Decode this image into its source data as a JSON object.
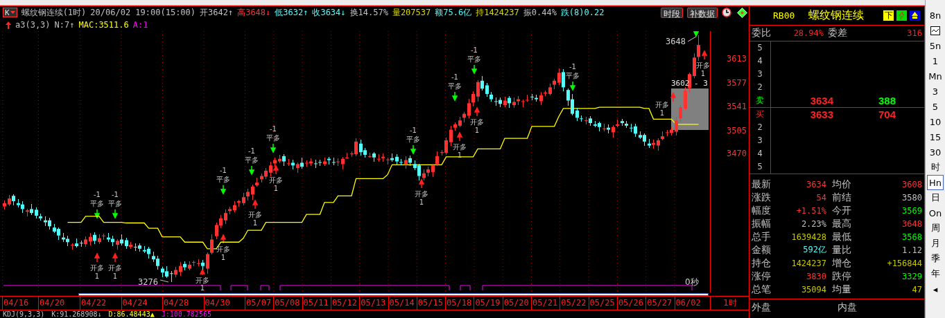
{
  "header": {
    "period_key": "K",
    "items": [
      {
        "text": "螺纹钢连续(1时)",
        "color": "#c0c0c0"
      },
      {
        "text": "20/06/02 19:00(15:00)",
        "color": "#c0c0c0"
      },
      {
        "text": "开3642↑",
        "color": "#c0c0c0"
      },
      {
        "text": "高3648↓",
        "color": "#ff3232"
      },
      {
        "text": "低3632↑",
        "color": "#54fcfc"
      },
      {
        "text": "收3634↓",
        "color": "#54fcfc"
      },
      {
        "text": "换14.57%",
        "color": "#c0c0c0"
      },
      {
        "text": "量207537",
        "color": "#d8d800"
      },
      {
        "text": "额75.6亿",
        "color": "#54fcfc"
      },
      {
        "text": "持1424237",
        "color": "#d8d800"
      },
      {
        "text": "振0.44%",
        "color": "#c0c0c0"
      },
      {
        "text": "跌(8)0.22",
        "color": "#54fcfc"
      }
    ],
    "buttons": [
      "时段",
      "补数据"
    ]
  },
  "indicator": [
    {
      "text": "a3(3,3)",
      "color": "#c0c0c0"
    },
    {
      "text": "N:7↑",
      "color": "#c0c0c0"
    },
    {
      "text": ":3511.6",
      "color": "#ffff00"
    },
    {
      "text": "A:1",
      "color": "#ff00ff"
    }
  ],
  "chart_data": {
    "type": "candlestick",
    "ylim": [
      3260,
      3655
    ],
    "yticks": [
      3470,
      3505,
      3541,
      3577,
      3613
    ],
    "ohlc": [
      [
        3390,
        3398,
        3386,
        3395
      ],
      [
        3393,
        3407,
        3391,
        3402
      ],
      [
        3406,
        3408,
        3392,
        3398
      ],
      [
        3395,
        3401,
        3389,
        3392
      ],
      [
        3393,
        3397,
        3381,
        3386
      ],
      [
        3382,
        3386,
        3375,
        3384
      ],
      [
        3386,
        3393,
        3378,
        3380
      ],
      [
        3385,
        3388,
        3372,
        3376
      ],
      [
        3375,
        3379,
        3369,
        3372
      ],
      [
        3369,
        3374,
        3361,
        3366
      ],
      [
        3369,
        3372,
        3356,
        3360
      ],
      [
        3358,
        3363,
        3350,
        3352
      ],
      [
        3356,
        3358,
        3340,
        3346
      ],
      [
        3343,
        3349,
        3337,
        3340
      ],
      [
        3341,
        3345,
        3331,
        3336
      ],
      [
        3332,
        3334,
        3325,
        3332
      ],
      [
        3334,
        3341,
        3328,
        3330
      ],
      [
        3335,
        3338,
        3330,
        3334
      ],
      [
        3333,
        3344,
        3330,
        3340
      ],
      [
        3337,
        3349,
        3332,
        3344
      ],
      [
        3347,
        3350,
        3334,
        3338
      ],
      [
        3336,
        3347,
        3334,
        3342
      ],
      [
        3346,
        3348,
        3340,
        3346
      ],
      [
        3343,
        3349,
        3337,
        3340
      ],
      [
        3341,
        3345,
        3331,
        3336
      ],
      [
        3332,
        3340,
        3325,
        3338
      ],
      [
        3340,
        3347,
        3332,
        3334
      ],
      [
        3339,
        3342,
        3326,
        3330
      ],
      [
        3329,
        3336,
        3326,
        3332
      ],
      [
        3329,
        3334,
        3323,
        3328
      ],
      [
        3331,
        3334,
        3322,
        3326
      ],
      [
        3324,
        3329,
        3320,
        3322
      ],
      [
        3326,
        3328,
        3312,
        3318
      ],
      [
        3315,
        3321,
        3307,
        3310
      ],
      [
        3311,
        3315,
        3295,
        3300
      ],
      [
        3296,
        3298,
        3283,
        3290
      ],
      [
        3292,
        3299,
        3282,
        3284
      ],
      [
        3289,
        3292,
        3276,
        3288
      ],
      [
        3287,
        3298,
        3284,
        3294
      ],
      [
        3291,
        3305,
        3286,
        3300
      ],
      [
        3303,
        3306,
        3294,
        3298
      ],
      [
        3296,
        3307,
        3294,
        3302
      ],
      [
        3306,
        3308,
        3300,
        3306
      ],
      [
        3303,
        3310,
        3300,
        3304
      ],
      [
        3305,
        3309,
        3295,
        3300
      ],
      [
        3296,
        3320,
        3289,
        3318
      ],
      [
        3320,
        3347,
        3318,
        3340
      ],
      [
        3345,
        3365,
        3341,
        3362
      ],
      [
        3361,
        3376,
        3358,
        3372
      ],
      [
        3369,
        3385,
        3364,
        3380
      ],
      [
        3383,
        3389,
        3379,
        3386
      ],
      [
        3384,
        3397,
        3382,
        3392
      ],
      [
        3396,
        3400,
        3390,
        3398
      ],
      [
        3395,
        3410,
        3392,
        3404
      ],
      [
        3405,
        3416,
        3400,
        3412
      ],
      [
        3408,
        3422,
        3401,
        3420
      ],
      [
        3422,
        3433,
        3420,
        3426
      ],
      [
        3431,
        3439,
        3427,
        3436
      ],
      [
        3435,
        3448,
        3432,
        3444
      ],
      [
        3441,
        3457,
        3436,
        3452
      ],
      [
        3455,
        3463,
        3451,
        3460
      ],
      [
        3458,
        3467,
        3456,
        3462
      ],
      [
        3466,
        3468,
        3452,
        3458
      ],
      [
        3455,
        3461,
        3452,
        3455
      ],
      [
        3456,
        3460,
        3447,
        3452
      ],
      [
        3448,
        3456,
        3441,
        3454
      ],
      [
        3456,
        3463,
        3448,
        3450
      ],
      [
        3455,
        3459,
        3451,
        3456
      ],
      [
        3455,
        3462,
        3452,
        3458
      ],
      [
        3455,
        3460,
        3449,
        3454
      ],
      [
        3457,
        3460,
        3452,
        3456
      ],
      [
        3454,
        3463,
        3452,
        3458
      ],
      [
        3462,
        3464,
        3454,
        3460
      ],
      [
        3457,
        3463,
        3453,
        3456
      ],
      [
        3457,
        3462,
        3452,
        3458
      ],
      [
        3454,
        3464,
        3447,
        3462
      ],
      [
        3464,
        3471,
        3462,
        3464
      ],
      [
        3469,
        3473,
        3465,
        3470
      ],
      [
        3469,
        3492,
        3466,
        3488
      ],
      [
        3485,
        3490,
        3467,
        3472
      ],
      [
        3475,
        3478,
        3464,
        3468
      ],
      [
        3466,
        3471,
        3464,
        3466
      ],
      [
        3470,
        3472,
        3458,
        3464
      ],
      [
        3461,
        3468,
        3458,
        3462
      ],
      [
        3463,
        3469,
        3458,
        3465
      ],
      [
        3461,
        3463,
        3454,
        3461
      ],
      [
        3463,
        3470,
        3458,
        3460
      ],
      [
        3465,
        3468,
        3454,
        3458
      ],
      [
        3457,
        3461,
        3453,
        3456
      ],
      [
        3453,
        3465,
        3448,
        3460
      ],
      [
        3463,
        3466,
        3452,
        3456
      ],
      [
        3454,
        3459,
        3446,
        3448
      ],
      [
        3452,
        3454,
        3430,
        3436
      ],
      [
        3433,
        3446,
        3430,
        3440
      ],
      [
        3441,
        3450,
        3436,
        3446
      ],
      [
        3442,
        3454,
        3435,
        3452
      ],
      [
        3454,
        3473,
        3452,
        3466
      ],
      [
        3471,
        3475,
        3467,
        3472
      ],
      [
        3471,
        3494,
        3468,
        3490
      ],
      [
        3487,
        3511,
        3482,
        3506
      ],
      [
        3509,
        3517,
        3505,
        3514
      ],
      [
        3512,
        3525,
        3510,
        3520
      ],
      [
        3524,
        3532,
        3518,
        3530
      ],
      [
        3527,
        3552,
        3524,
        3546
      ],
      [
        3547,
        3564,
        3542,
        3560
      ],
      [
        3556,
        3580,
        3549,
        3578
      ],
      [
        3580,
        3587,
        3566,
        3568
      ],
      [
        3573,
        3576,
        3556,
        3560
      ],
      [
        3559,
        3563,
        3549,
        3552
      ],
      [
        3549,
        3554,
        3543,
        3548
      ],
      [
        3551,
        3554,
        3541,
        3545
      ],
      [
        3543,
        3555,
        3541,
        3550
      ],
      [
        3554,
        3556,
        3540,
        3546
      ],
      [
        3543,
        3554,
        3540,
        3548
      ],
      [
        3549,
        3556,
        3544,
        3552
      ],
      [
        3548,
        3551,
        3541,
        3549
      ],
      [
        3551,
        3558,
        3549,
        3551
      ],
      [
        3556,
        3559,
        3551,
        3555
      ],
      [
        3554,
        3558,
        3549,
        3552
      ],
      [
        3549,
        3563,
        3544,
        3558
      ],
      [
        3561,
        3565,
        3557,
        3562
      ],
      [
        3560,
        3575,
        3558,
        3570
      ],
      [
        3574,
        3582,
        3568,
        3580
      ],
      [
        3577,
        3598,
        3574,
        3592
      ],
      [
        3593,
        3597,
        3565,
        3570
      ],
      [
        3566,
        3568,
        3543,
        3550
      ],
      [
        3552,
        3559,
        3528,
        3530
      ],
      [
        3535,
        3538,
        3520,
        3524
      ],
      [
        3523,
        3527,
        3519,
        3522
      ],
      [
        3519,
        3525,
        3514,
        3520
      ],
      [
        3523,
        3526,
        3512,
        3516
      ],
      [
        3514,
        3519,
        3510,
        3512
      ],
      [
        3516,
        3518,
        3504,
        3510
      ],
      [
        3507,
        3514,
        3504,
        3508
      ],
      [
        3509,
        3513,
        3501,
        3506
      ],
      [
        3502,
        3512,
        3495,
        3510
      ],
      [
        3512,
        3521,
        3510,
        3514
      ],
      [
        3519,
        3522,
        3512,
        3516
      ],
      [
        3515,
        3519,
        3509,
        3512
      ],
      [
        3509,
        3514,
        3503,
        3508
      ],
      [
        3511,
        3514,
        3496,
        3500
      ],
      [
        3498,
        3503,
        3492,
        3494
      ],
      [
        3498,
        3500,
        3482,
        3488
      ],
      [
        3485,
        3491,
        3479,
        3482
      ],
      [
        3483,
        3490,
        3478,
        3486
      ],
      [
        3482,
        3492,
        3475,
        3490
      ],
      [
        3492,
        3503,
        3490,
        3496
      ],
      [
        3501,
        3505,
        3497,
        3502
      ],
      [
        3501,
        3510,
        3498,
        3506
      ],
      [
        3503,
        3525,
        3498,
        3520
      ],
      [
        3523,
        3543,
        3519,
        3540
      ],
      [
        3538,
        3570,
        3536,
        3565
      ],
      [
        3569,
        3592,
        3563,
        3590
      ],
      [
        3587,
        3621,
        3584,
        3615
      ],
      [
        3616,
        3648,
        3611,
        3634
      ]
    ],
    "series": [
      {
        "name": "MAC",
        "type": "line",
        "color": "#ffff00",
        "values": [
          null,
          null,
          null,
          null,
          null,
          null,
          null,
          null,
          null,
          null,
          null,
          null,
          null,
          null,
          3366,
          3366,
          3366,
          3366,
          3375,
          3375,
          3375,
          3375,
          3366,
          3366,
          3366,
          3366,
          3366,
          3365,
          3365,
          3365,
          3365,
          3365,
          3357,
          3357,
          3357,
          3344,
          3344,
          3344,
          3344,
          3344,
          3336,
          3336,
          3336,
          3336,
          3336,
          3326,
          3326,
          3326,
          3336,
          3336,
          3336,
          3336,
          3336,
          3342,
          3354,
          3354,
          3354,
          3354,
          3366,
          3366,
          3366,
          3366,
          3366,
          3366,
          3366,
          3366,
          3366,
          3378,
          3378,
          3378,
          3378,
          3396,
          3396,
          3396,
          3406,
          3406,
          3406,
          3406,
          3432,
          3432,
          3432,
          3432,
          3432,
          3432,
          3432,
          3438,
          3453,
          3453,
          3453,
          3453,
          3453,
          3453,
          3453,
          3453,
          3453,
          3453,
          3453,
          3453,
          3465,
          3465,
          3465,
          3465,
          3465,
          3465,
          3465,
          3477,
          3477,
          3477,
          3477,
          3477,
          3477,
          3493,
          3493,
          3493,
          3493,
          3493,
          3493,
          3511,
          3511,
          3511,
          3511,
          3511,
          3511,
          3526,
          3538,
          3538,
          3538,
          3538,
          3538,
          3538,
          3538,
          3538,
          3540,
          3540,
          3540,
          3540,
          3540,
          3540,
          3540,
          3540,
          3540,
          3540,
          3538,
          3538,
          3522,
          3522,
          3522,
          3522,
          3522,
          3514,
          3514,
          3514,
          3514,
          3514,
          3514
        ]
      }
    ],
    "annotations": [
      "平多",
      "-1",
      "平多",
      "-1",
      "平多",
      "-1",
      "平多",
      "-1",
      "平多",
      "-1",
      "平多",
      "-1",
      "平多",
      "-1",
      "平多",
      "-1",
      "平多",
      "-1",
      "开多",
      "1",
      "开多",
      "1",
      "开多",
      "1",
      "开多",
      "1",
      "开多",
      "1",
      "开多",
      "1",
      "开多",
      "1",
      "开多",
      "1",
      "开多",
      "1",
      "开多",
      "1",
      "开多",
      "1",
      "3648",
      "3276",
      "3602 - 3"
    ]
  },
  "countdown": "0秒",
  "date_axis": {
    "dates": [
      "04/16",
      "04/20",
      "04/22",
      "04/24",
      "04/28",
      "04/30",
      "05/07",
      "05/08",
      "05/11",
      "05/12",
      "05/13",
      "05/14",
      "05/15",
      "05/18",
      "05/19",
      "05/20",
      "05/21",
      "05/22",
      "05/25",
      "05/26",
      "05/27",
      "06/02"
    ],
    "period": "1时"
  },
  "kdj": [
    {
      "text": "KDJ(9,3,3)",
      "color": "#c0c0c0"
    },
    {
      "text": "K:91.268908↓",
      "color": "#c0c0c0"
    },
    {
      "text": "D:86.48443▲",
      "color": "#ffff00"
    },
    {
      "text": "J:100.782565",
      "color": "#ff00ff"
    }
  ],
  "quote_panel": {
    "code": "RB00",
    "name": "螺纹钢连续",
    "badge": "下",
    "ratio": {
      "label": "委比",
      "value": "28.94%",
      "diff_label": "委差",
      "diff_value": "316"
    },
    "asks": [
      {
        "rank": "5"
      },
      {
        "rank": "4"
      },
      {
        "rank": "3"
      },
      {
        "rank": "2"
      },
      {
        "rank": "卖",
        "price": "3634",
        "volume": "388"
      }
    ],
    "bids": [
      {
        "rank": "买",
        "price": "3633",
        "volume": "704"
      },
      {
        "rank": "2"
      },
      {
        "rank": "3"
      },
      {
        "rank": "4"
      },
      {
        "rank": "5"
      }
    ],
    "stats": [
      {
        "label": "最新",
        "value": "3634",
        "color": "#ff3232"
      },
      {
        "label": "均价",
        "value": "3608",
        "color": "#ff3232"
      },
      {
        "label": "涨跌",
        "value": "54",
        "color": "#ff3232"
      },
      {
        "label": "前结",
        "value": "3580",
        "color": "#c0c0c0"
      },
      {
        "label": "幅度",
        "value": "+1.51%",
        "color": "#ff3232"
      },
      {
        "label": "今开",
        "value": "3569",
        "color": "#00ff00"
      },
      {
        "label": "振幅",
        "value": "2.23%",
        "color": "#c0c0c0"
      },
      {
        "label": "最高",
        "value": "3648",
        "color": "#ff3232"
      },
      {
        "label": "总手",
        "value": "1639428",
        "color": "#c8c800"
      },
      {
        "label": "最低",
        "value": "3568",
        "color": "#00ff00"
      },
      {
        "label": "金额",
        "value": "592亿",
        "color": "#54fcfc"
      },
      {
        "label": "量比",
        "value": "1.12",
        "color": "#c0c0c0"
      },
      {
        "label": "持仓",
        "value": "1424237",
        "color": "#c8c800"
      },
      {
        "label": "增仓",
        "value": "+156844",
        "color": "#c8c800"
      },
      {
        "label": "涨停",
        "value": "3830",
        "color": "#ff3232"
      },
      {
        "label": "跌停",
        "value": "3329",
        "color": "#00ff00"
      },
      {
        "label": "总笔",
        "value": "35094",
        "color": "#c8c800"
      },
      {
        "label": "均量",
        "value": "47",
        "color": "#c8c800"
      }
    ],
    "footer": [
      "外盘",
      "内盘"
    ]
  },
  "toolbar": [
    {
      "kind": "text",
      "label": "8n",
      "selected": false
    },
    {
      "kind": "chart",
      "selected": false
    },
    {
      "kind": "text",
      "label": "5n",
      "selected": false
    },
    {
      "kind": "text",
      "label": "1",
      "selected": false
    },
    {
      "kind": "text",
      "label": "Mn",
      "selected": false
    },
    {
      "kind": "text",
      "label": "3",
      "selected": false
    },
    {
      "kind": "text",
      "label": "5",
      "selected": false
    },
    {
      "kind": "text",
      "label": "10",
      "selected": false
    },
    {
      "kind": "text",
      "label": "15",
      "selected": false
    },
    {
      "kind": "text",
      "label": "30",
      "selected": false
    },
    {
      "kind": "text",
      "label": "时",
      "selected": false
    },
    {
      "kind": "text",
      "label": "Hn",
      "selected": true
    },
    {
      "kind": "text",
      "label": "日",
      "selected": false
    },
    {
      "kind": "text",
      "label": "On",
      "selected": false
    },
    {
      "kind": "text",
      "label": "周",
      "selected": false
    },
    {
      "kind": "text",
      "label": "月",
      "selected": false
    },
    {
      "kind": "text",
      "label": "季",
      "selected": false
    },
    {
      "kind": "text",
      "label": "年",
      "selected": false
    },
    {
      "kind": "text",
      "label": "◂",
      "selected": false
    }
  ]
}
